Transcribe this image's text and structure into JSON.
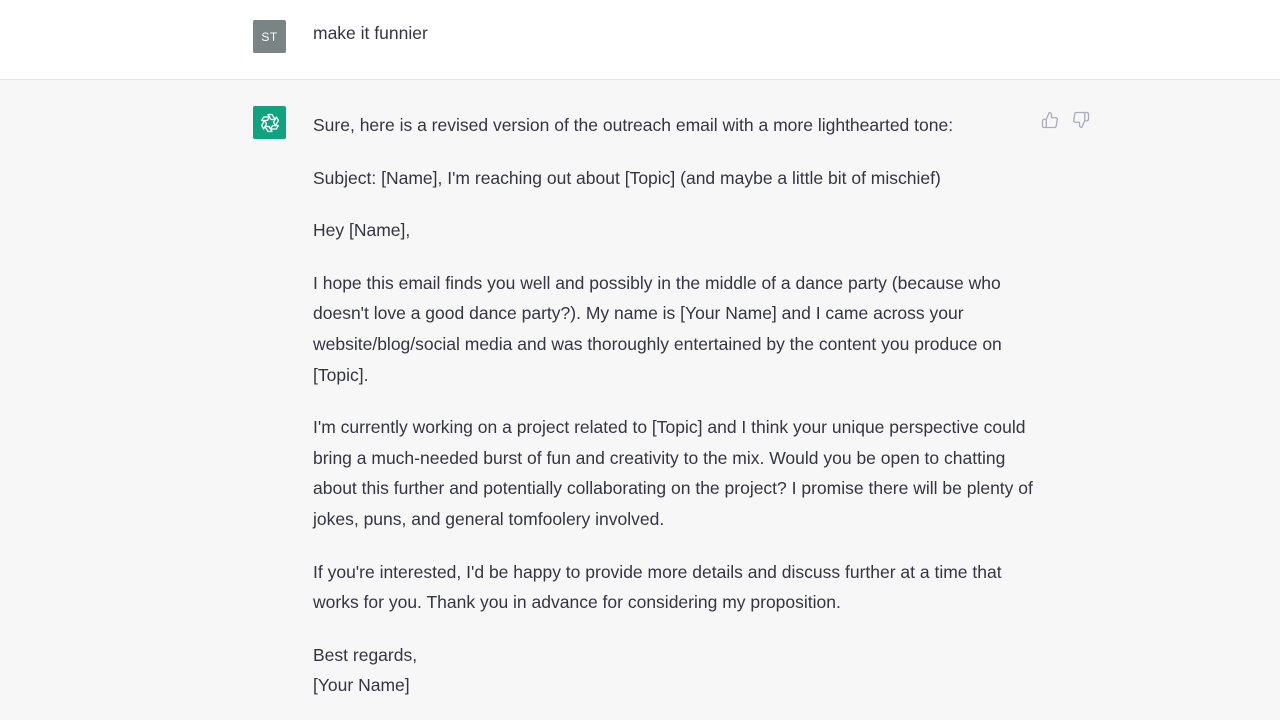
{
  "user_turn": {
    "avatar_initials": "ST",
    "message": "make it funnier"
  },
  "assistant_turn": {
    "avatar_icon": "openai-logo-icon",
    "paragraphs": [
      "Sure, here is a revised version of the outreach email with a more lighthearted tone:",
      "Subject: [Name], I'm reaching out about [Topic] (and maybe a little bit of mischief)",
      "Hey [Name],",
      "I hope this email finds you well and possibly in the middle of a dance party (because who doesn't love a good dance party?). My name is [Your Name] and I came across your website/blog/social media and was thoroughly entertained by the content you produce on [Topic].",
      "I'm currently working on a project related to [Topic] and I think your unique perspective could bring a much-needed burst of fun and creativity to the mix. Would you be open to chatting about this further and potentially collaborating on the project? I promise there will be plenty of jokes, puns, and general tomfoolery involved.",
      "If you're interested, I'd be happy to provide more details and discuss further at a time that works for you. Thank you in advance for considering my proposition.",
      "Best regards,",
      "[Your Name]"
    ],
    "feedback": {
      "thumbs_up_icon": "thumbs-up-icon",
      "thumbs_down_icon": "thumbs-down-icon"
    }
  },
  "colors": {
    "user_bg": "#ffffff",
    "assistant_bg": "#f7f7f8",
    "user_avatar_bg": "#7a8484",
    "assistant_avatar_bg": "#10a37f",
    "text": "#343541",
    "icon": "#acacbe"
  }
}
